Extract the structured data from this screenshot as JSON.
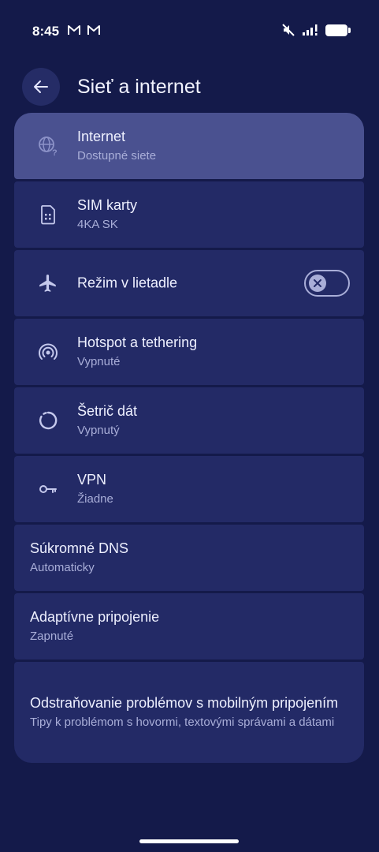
{
  "status_bar": {
    "time": "8:45",
    "icons": [
      "gmail-icon",
      "gmail-icon",
      "mute-icon",
      "signal-icon",
      "battery-icon"
    ]
  },
  "header": {
    "title": "Sieť a internet",
    "back_icon": "arrow-left-icon"
  },
  "items": [
    {
      "title": "Internet",
      "subtitle": "Dostupné siete",
      "icon": "globe-question-icon"
    },
    {
      "title": "SIM karty",
      "subtitle": "4KA SK",
      "icon": "sim-card-icon"
    },
    {
      "title": "Režim v lietadle",
      "icon": "airplane-icon",
      "toggle": false
    },
    {
      "title": "Hotspot a tethering",
      "subtitle": "Vypnuté",
      "icon": "hotspot-icon"
    },
    {
      "title": "Šetrič dát",
      "subtitle": "Vypnutý",
      "icon": "data-saver-icon"
    },
    {
      "title": "VPN",
      "subtitle": "Žiadne",
      "icon": "vpn-key-icon"
    },
    {
      "title": "Súkromné DNS",
      "subtitle": "Automaticky"
    },
    {
      "title": "Adaptívne pripojenie",
      "subtitle": "Zapnuté"
    },
    {
      "title": "Odstraňovanie problémov s mobilným pripojením",
      "subtitle": "Tipy k problémom s hovormi, textovými správami a dátami"
    }
  ],
  "colors": {
    "background": "#141a4a",
    "card": "#232a66",
    "highlighted_card": "#4a5190",
    "secondary_text": "#a9aed8"
  }
}
